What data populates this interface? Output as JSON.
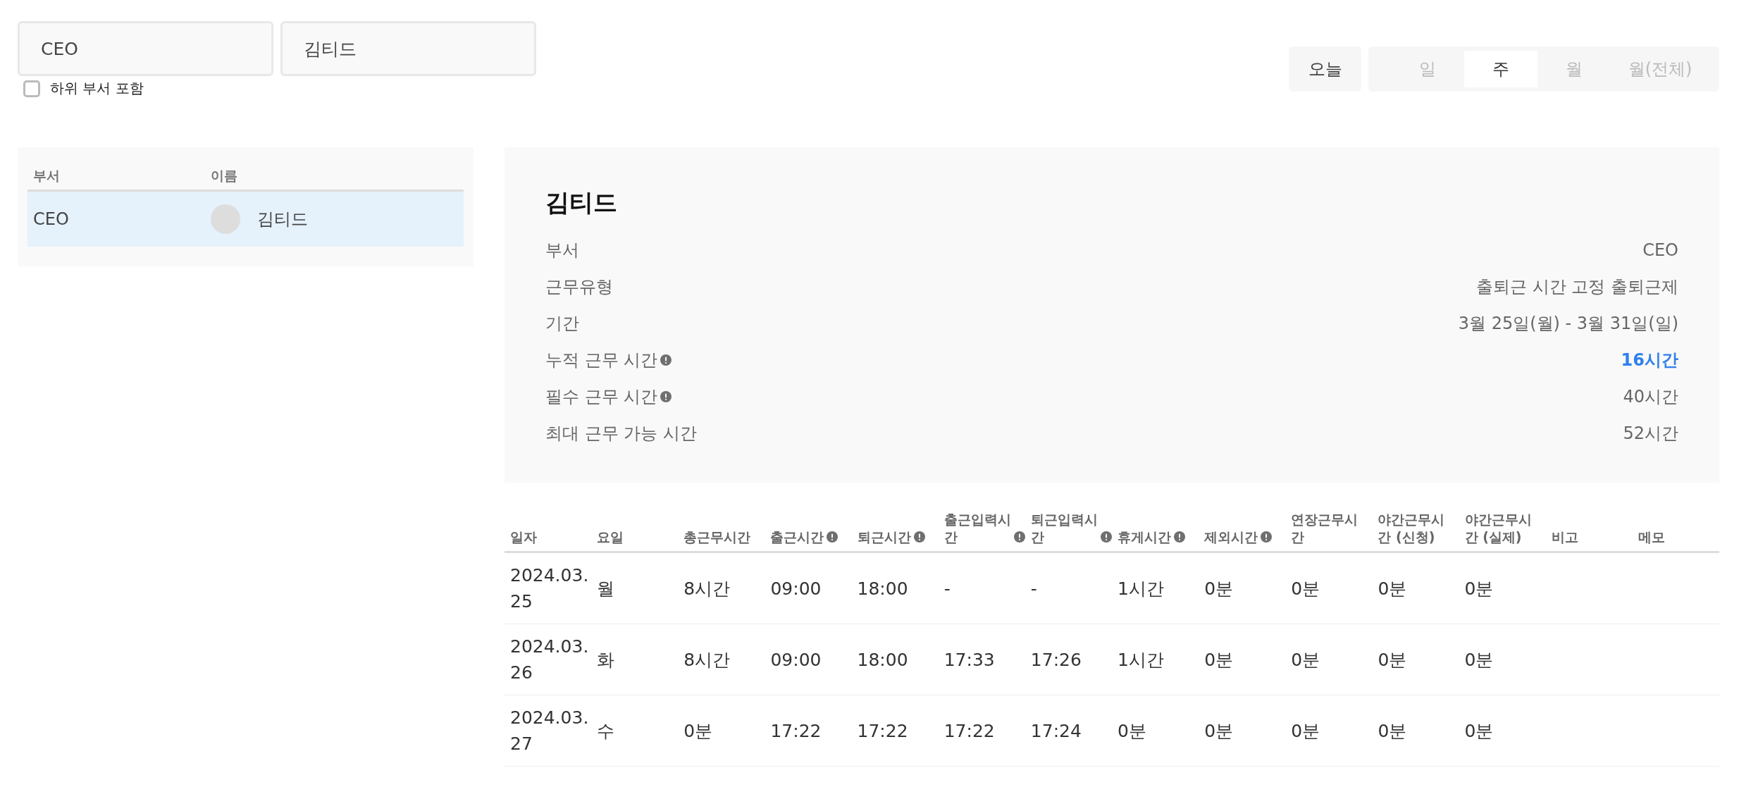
{
  "filters": {
    "department": {
      "value": "CEO"
    },
    "employee": {
      "value": "김티드"
    },
    "include_subdepartments": {
      "label": "하위 부서 포함",
      "checked": false
    }
  },
  "period_controls": {
    "today_button": "오늘",
    "periods": [
      {
        "label": "일",
        "selected": false
      },
      {
        "label": "주",
        "selected": true
      },
      {
        "label": "월",
        "selected": false
      },
      {
        "label": "월(전체)",
        "selected": false
      }
    ]
  },
  "employee_list": {
    "columns": [
      "부서",
      "이름"
    ],
    "rows": [
      {
        "department": "CEO",
        "name": "김티드",
        "selected": true
      }
    ]
  },
  "summary": {
    "title": "김티드",
    "rows": [
      {
        "label": "부서",
        "value": "CEO",
        "info": false,
        "emphasis": false
      },
      {
        "label": "근무유형",
        "value": "출퇴근 시간 고정 출퇴근제",
        "info": false,
        "emphasis": false
      },
      {
        "label": "기간",
        "value": "3월 25일(월) - 3월 31일(일)",
        "info": false,
        "emphasis": false
      },
      {
        "label": "누적 근무 시간",
        "value": "16시간",
        "info": true,
        "emphasis": true
      },
      {
        "label": "필수 근무 시간",
        "value": "40시간",
        "info": true,
        "emphasis": false
      },
      {
        "label": "최대 근무 가능 시간",
        "value": "52시간",
        "info": false,
        "emphasis": false
      }
    ]
  },
  "attendance_table": {
    "columns": [
      {
        "label": "일자",
        "info": false
      },
      {
        "label": "요일",
        "info": false
      },
      {
        "label": "총근무시간",
        "info": false
      },
      {
        "label": "출근시간",
        "info": true
      },
      {
        "label": "퇴근시간",
        "info": true
      },
      {
        "label": "출근입력시간",
        "info": true
      },
      {
        "label": "퇴근입력시간",
        "info": true
      },
      {
        "label": "휴게시간",
        "info": true
      },
      {
        "label": "제외시간",
        "info": true
      },
      {
        "label": "연장근무시간",
        "info": false
      },
      {
        "label": "야간근무시간 (신청)",
        "info": false
      },
      {
        "label": "야간근무시간 (실제)",
        "info": false
      },
      {
        "label": "비고",
        "info": false
      },
      {
        "label": "메모",
        "info": false
      }
    ],
    "rows": [
      {
        "cells": [
          "2024.03.25",
          "월",
          "8시간",
          "09:00",
          "18:00",
          "-",
          "-",
          "1시간",
          "0분",
          "0분",
          "0분",
          "0분"
        ]
      },
      {
        "cells": [
          "2024.03.26",
          "화",
          "8시간",
          "09:00",
          "18:00",
          "17:33",
          "17:26",
          "1시간",
          "0분",
          "0분",
          "0분",
          "0분"
        ]
      },
      {
        "cells": [
          "2024.03.27",
          "수",
          "0분",
          "17:22",
          "17:22",
          "17:22",
          "17:24",
          "0분",
          "0분",
          "0분",
          "0분",
          "0분"
        ]
      }
    ]
  }
}
